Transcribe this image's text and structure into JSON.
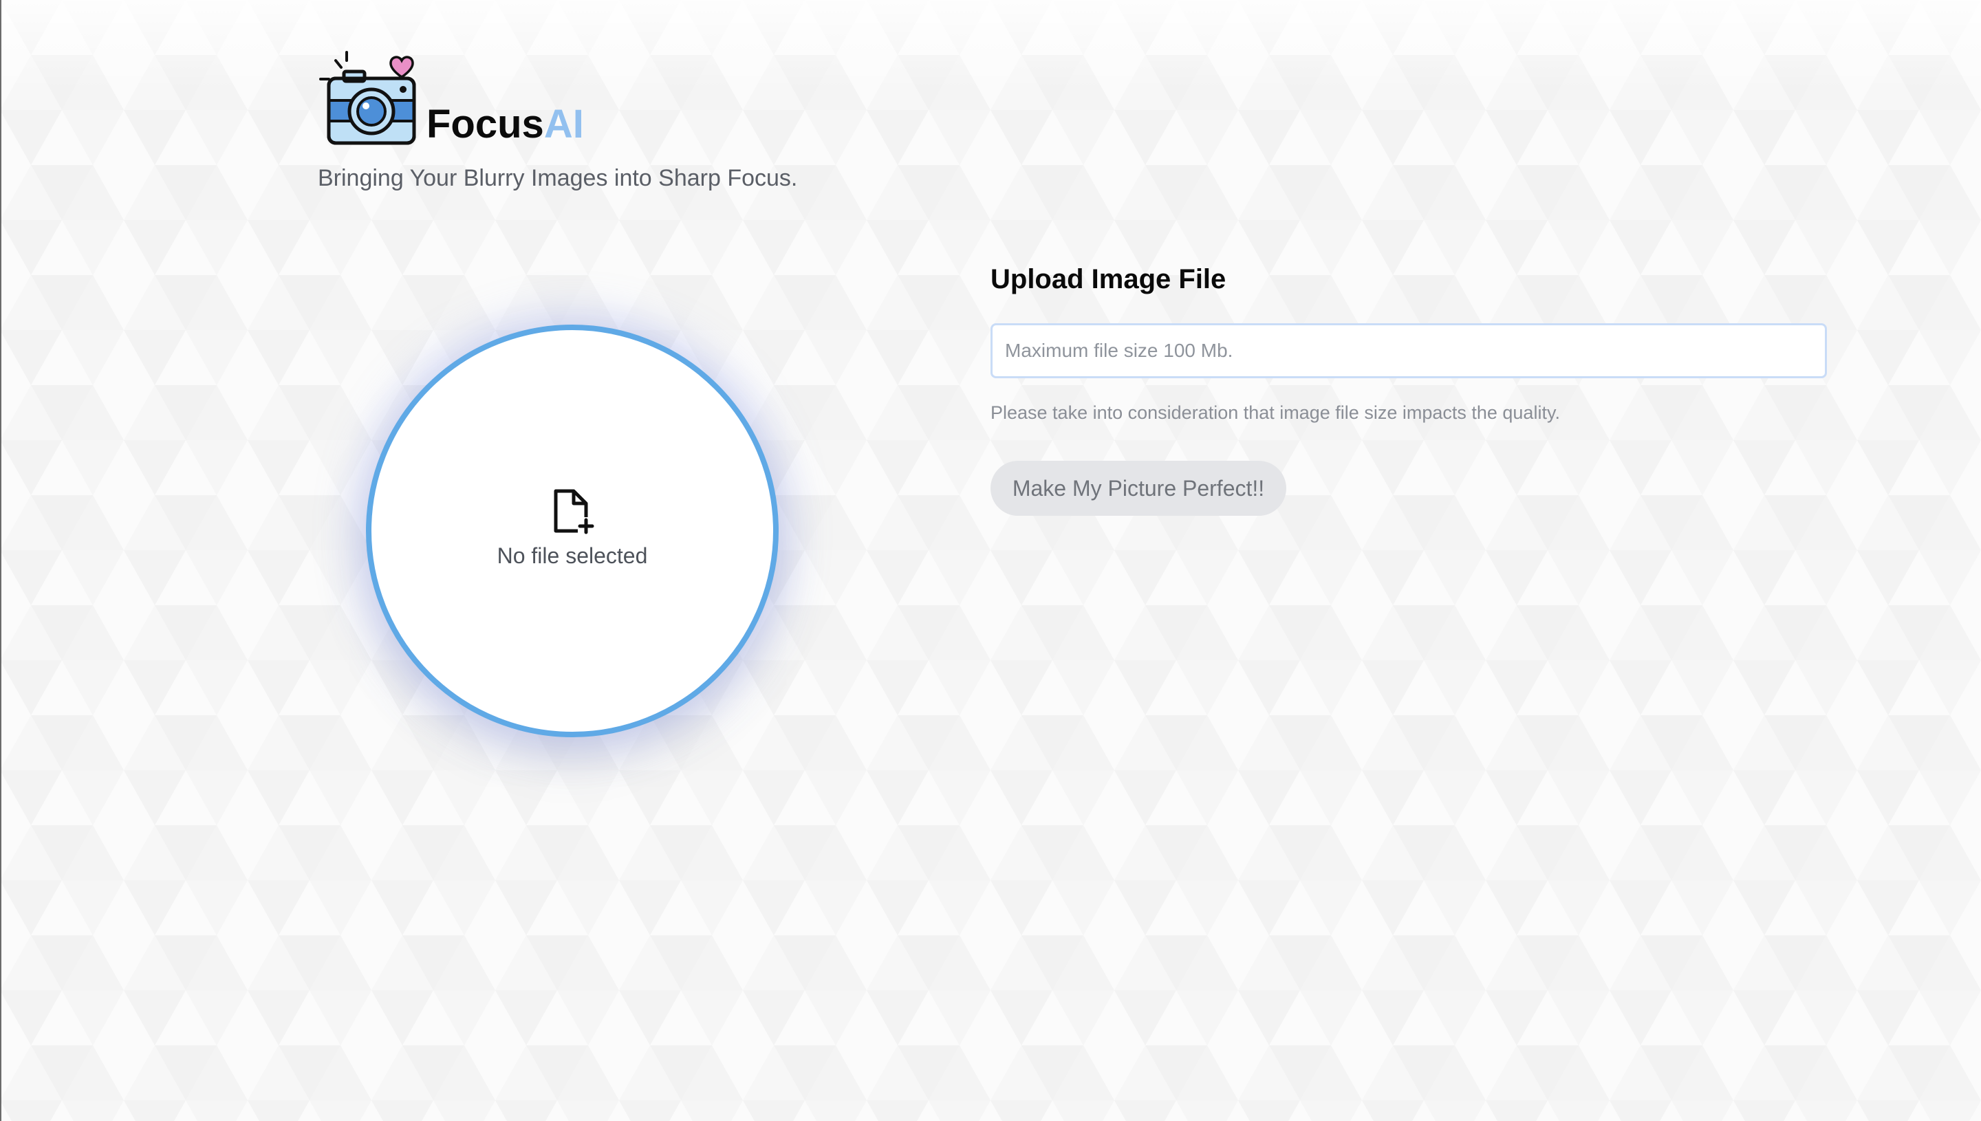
{
  "brand": {
    "name_main": "Focus",
    "name_accent": "AI",
    "tagline": "Bringing Your Blurry Images into Sharp Focus.",
    "logo_icon": "camera-heart-icon"
  },
  "dropzone": {
    "icon": "file-plus-icon",
    "status": "No file selected"
  },
  "upload": {
    "title": "Upload Image File",
    "placeholder": "Maximum file size 100 Mb.",
    "hint": "Please take into consideration that image file size impacts the quality.",
    "button_label": "Make My Picture Perfect!!"
  },
  "colors": {
    "accent_blue": "#5fa9e6",
    "brand_accent": "#92c0ef",
    "button_bg": "#e4e5e8"
  }
}
